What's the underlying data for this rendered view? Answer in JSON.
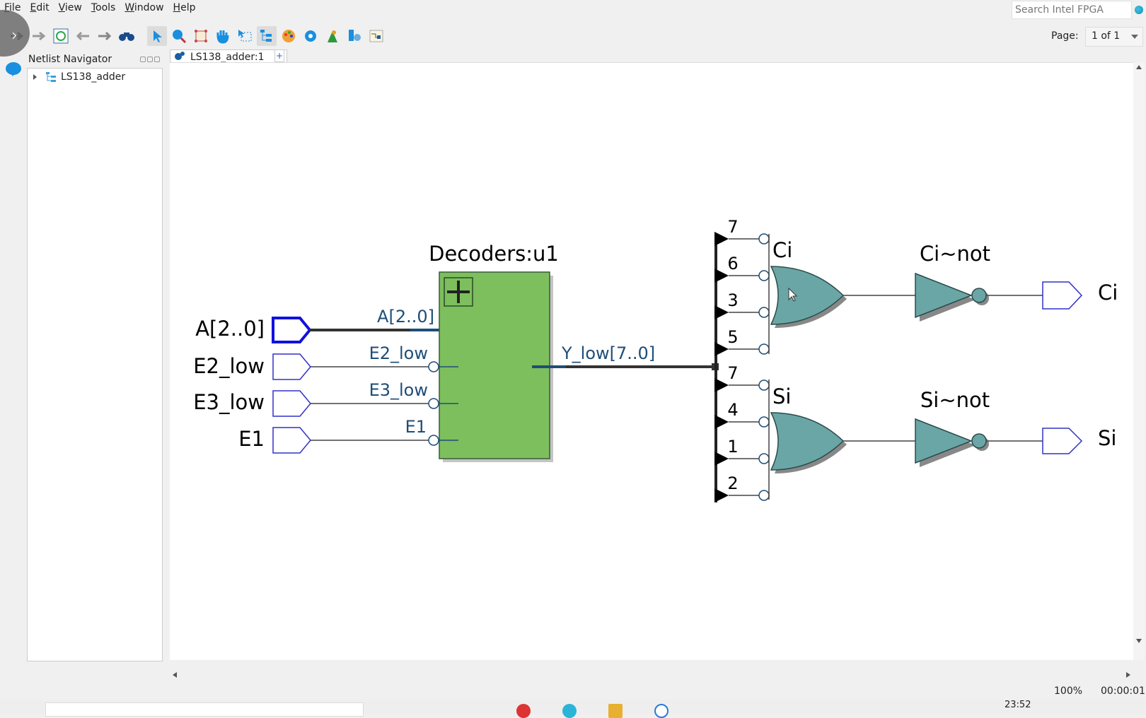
{
  "menubar": {
    "items": [
      "File",
      "Edit",
      "View",
      "Tools",
      "Window",
      "Help"
    ],
    "search_placeholder": "Search Intel FPGA"
  },
  "toolbar": {
    "icons": [
      "back-icon",
      "forward-icon",
      "refresh-icon",
      "previous-icon",
      "next-icon",
      "find-icon",
      "select-icon",
      "zoom-icon",
      "fit-icon",
      "pan-icon",
      "area-select-icon",
      "hierarchy-icon",
      "color-palette-icon",
      "settings-icon",
      "bird-icon",
      "filter-icon",
      "export-icon"
    ],
    "page_label": "Page:",
    "page_value": "1 of 1"
  },
  "navigator": {
    "title": "Netlist Navigator",
    "tree": [
      {
        "label": "LS138_adder",
        "expanded": false
      }
    ]
  },
  "tabs": [
    {
      "label": "LS138_adder:1",
      "active": true
    }
  ],
  "schematic": {
    "inputs": [
      {
        "label": "A[2..0]",
        "bus": true
      },
      {
        "label": "E2_low",
        "bus": false
      },
      {
        "label": "E3_low",
        "bus": false
      },
      {
        "label": "E1",
        "bus": false
      }
    ],
    "decoder": {
      "name": "Decoders:u1",
      "ports_in": [
        "A[2..0]",
        "E2_low",
        "E3_low",
        "E1"
      ],
      "port_out": "Y_low[7..0]",
      "inverted_inputs": [
        "E2_low",
        "E3_low",
        "E1"
      ]
    },
    "gates": [
      {
        "name": "Ci",
        "type": "OR",
        "taps": [
          "7",
          "6",
          "3",
          "5"
        ],
        "not_name": "Ci~not",
        "output": "Ci"
      },
      {
        "name": "Si",
        "type": "OR",
        "taps": [
          "7",
          "4",
          "1",
          "2"
        ],
        "not_name": "Si~not",
        "output": "Si"
      }
    ]
  },
  "status": {
    "zoom": "100%",
    "elapsed": "00:00:01"
  },
  "taskbar": {
    "clock": "23:52"
  },
  "colors": {
    "decoder_fill": "#7dbf5c",
    "gate_fill": "#6ba6a6",
    "port_stroke": "#2a2ad0",
    "wire_label": "#1e4e78"
  }
}
